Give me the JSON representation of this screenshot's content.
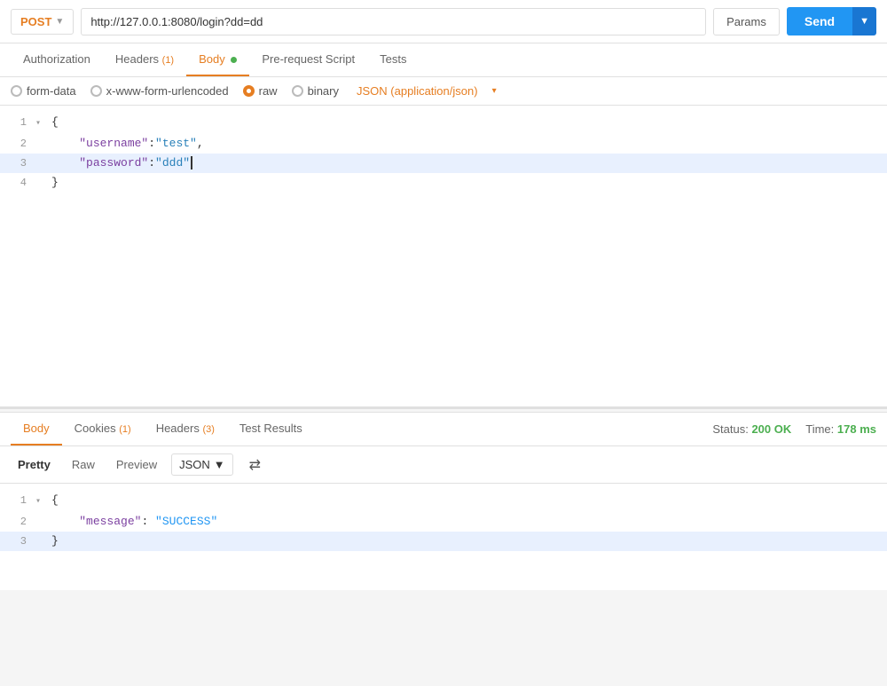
{
  "topbar": {
    "method": "POST",
    "chevron": "▼",
    "url": "http://127.0.0.1:8080/login?dd=dd",
    "params_label": "Params",
    "send_label": "Send",
    "send_dropdown": "▼"
  },
  "request_tabs": [
    {
      "id": "authorization",
      "label": "Authorization",
      "active": false,
      "badge": null,
      "dot": false
    },
    {
      "id": "headers",
      "label": "Headers",
      "active": false,
      "badge": "(1)",
      "dot": false
    },
    {
      "id": "body",
      "label": "Body",
      "active": true,
      "badge": null,
      "dot": true
    },
    {
      "id": "pre-request-script",
      "label": "Pre-request Script",
      "active": false,
      "badge": null,
      "dot": false
    },
    {
      "id": "tests",
      "label": "Tests",
      "active": false,
      "badge": null,
      "dot": false
    }
  ],
  "body_types": [
    {
      "id": "form-data",
      "label": "form-data",
      "selected": false
    },
    {
      "id": "x-www-form-urlencoded",
      "label": "x-www-form-urlencoded",
      "selected": false
    },
    {
      "id": "raw",
      "label": "raw",
      "selected": true
    },
    {
      "id": "binary",
      "label": "binary",
      "selected": false
    }
  ],
  "json_type_label": "JSON (application/json)",
  "request_code": {
    "lines": [
      {
        "num": "1",
        "toggle": "▾",
        "content": "{",
        "highlighted": false
      },
      {
        "num": "2",
        "toggle": "",
        "key": "\"username\"",
        "colon": ":",
        "value": "\"test\"",
        "comma": ",",
        "highlighted": false
      },
      {
        "num": "3",
        "toggle": "",
        "key": "\"password\"",
        "colon": ":",
        "value": "\"ddd\"",
        "comma": "",
        "cursor": true,
        "highlighted": true
      },
      {
        "num": "4",
        "toggle": "",
        "content": "}",
        "highlighted": false
      }
    ]
  },
  "response_tabs": [
    {
      "id": "body",
      "label": "Body",
      "active": true,
      "badge": null
    },
    {
      "id": "cookies",
      "label": "Cookies",
      "active": false,
      "badge": "(1)"
    },
    {
      "id": "headers",
      "label": "Headers",
      "active": false,
      "badge": "(3)"
    },
    {
      "id": "test-results",
      "label": "Test Results",
      "active": false,
      "badge": null
    }
  ],
  "response_meta": {
    "status_label": "Status:",
    "status_value": "200 OK",
    "time_label": "Time:",
    "time_value": "178 ms"
  },
  "format_tabs": [
    {
      "id": "pretty",
      "label": "Pretty",
      "active": true
    },
    {
      "id": "raw",
      "label": "Raw",
      "active": false
    },
    {
      "id": "preview",
      "label": "Preview",
      "active": false
    }
  ],
  "format_select": {
    "value": "JSON",
    "chevron": "▼"
  },
  "response_code": {
    "lines": [
      {
        "num": "1",
        "toggle": "▾",
        "content": "{",
        "highlighted": false
      },
      {
        "num": "2",
        "toggle": "",
        "key": "\"message\"",
        "colon": ":",
        "value": "\"SUCCESS\"",
        "highlighted": false
      },
      {
        "num": "3",
        "toggle": "",
        "content": "}",
        "highlighted": true
      }
    ]
  }
}
